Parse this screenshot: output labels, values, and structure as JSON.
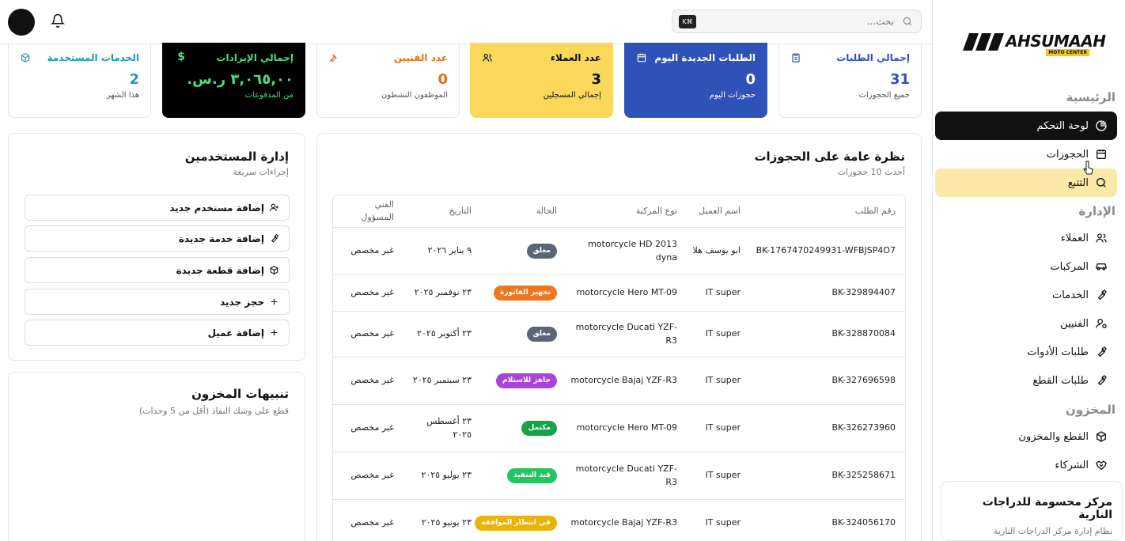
{
  "topbar": {
    "search_placeholder": "بحث...",
    "search_shortcut": "⌘K"
  },
  "sidebar": {
    "logo_text": "AHSUMAAH",
    "logo_sub": "MOTO CENTER",
    "section_main": "الرئيسية",
    "section_admin": "الإدارة",
    "section_inventory": "المخزون",
    "items": {
      "dashboard": "لوحة التحكم",
      "bookings": "الحجوزات",
      "tracking": "التتبع",
      "customers": "العملاء",
      "vehicles": "المركبات",
      "services": "الخدمات",
      "technicians": "الفنيين",
      "tool_requests": "طلبات الأدوات",
      "parts_requests": "طلبات القطع",
      "parts_inventory": "القطع والمخزون",
      "partners": "الشركاء"
    },
    "center_name": "مركز محسومة للدراجات النارية",
    "center_sub": "نظام إدارة مركز الدراجات النارية"
  },
  "stats": {
    "total_orders": {
      "label": "إجمالي الطلبات",
      "value": "31",
      "sub": "جميع الحجوزات"
    },
    "new_today": {
      "label": "الطلبات الجديدة اليوم",
      "value": "0",
      "sub": "حجوزات اليوم"
    },
    "customers": {
      "label": "عدد العملاء",
      "value": "3",
      "sub": "إجمالي المسجلين"
    },
    "technicians": {
      "label": "عدد الفنيين",
      "value": "0",
      "sub": "الموظفون النشطون"
    },
    "revenue": {
      "label": "إجمالي الإيرادات",
      "value": "٣,٠٦٥,٠٠ ر.س.",
      "sub": "من المدفوعات"
    },
    "services": {
      "label": "الخدمات المستخدمة",
      "value": "2",
      "sub": "هذا الشهر"
    }
  },
  "bookings_panel": {
    "title": "نظرة عامة على الحجوزات",
    "subtitle": "أحدث 10 حجوزات",
    "columns": {
      "order": "رقم الطلب",
      "customer": "اسم العميل",
      "vehicle": "نوع المركبة",
      "status": "الحالة",
      "date": "التاريخ",
      "tech": "الفني المسؤول"
    },
    "rows": [
      {
        "order": "BK-1767470249931-WFBJSP4O7",
        "customer": "ابو يوسف هلا",
        "vehicle": "motorcycle HD 2013 dyna",
        "status": "مغلق",
        "status_color": "#5a6675",
        "date": "٩ يناير ٢٠٢٦",
        "tech": "غير مخصص"
      },
      {
        "order": "BK-329894407",
        "customer": "IT super",
        "vehicle": "motorcycle Hero MT-09",
        "status": "تجهيز الفاتورة",
        "status_color": "#f07520",
        "date": "٢٣ نوفمبر ٢٠٢٥",
        "tech": "غير مخصص"
      },
      {
        "order": "BK-328870084",
        "customer": "IT super",
        "vehicle": "motorcycle Ducati YZF-R3",
        "status": "مغلق",
        "status_color": "#5a6675",
        "date": "٢٣ أكتوبر ٢٠٢٥",
        "tech": "غير مخصص"
      },
      {
        "order": "BK-327696598",
        "customer": "IT super",
        "vehicle": "motorcycle Bajaj YZF-R3",
        "status": "جاهز للاستلام",
        "status_color": "#a845d8",
        "date": "٢٣ سبتمبر ٢٠٢٥",
        "tech": "غير مخصص"
      },
      {
        "order": "BK-326273960",
        "customer": "IT super",
        "vehicle": "motorcycle Hero MT-09",
        "status": "مكتمل",
        "status_color": "#16a34a",
        "date": "٢٣ أغسطس ٢٠٢٥",
        "tech": "غير مخصص"
      },
      {
        "order": "BK-325258671",
        "customer": "IT super",
        "vehicle": "motorcycle Ducati YZF-R3",
        "status": "قيد التنفيذ",
        "status_color": "#22c55e",
        "date": "٢٣ يوليو ٢٠٢٥",
        "tech": "غير مخصص"
      },
      {
        "order": "BK-324056170",
        "customer": "IT super",
        "vehicle": "motorcycle Bajaj YZF-R3",
        "status": "في انتظار الموافقة",
        "status_color": "#eab308",
        "date": "٢٣ يونيو ٢٠٢٥",
        "tech": "غير مخصص"
      }
    ]
  },
  "users_panel": {
    "title": "إدارة المستخدمين",
    "subtitle": "إجراءات سريعة",
    "actions": [
      "إضافة مستخدم جديد",
      "إضافة خدمة جديدة",
      "إضافة قطعة جديدة",
      "حجز جديد",
      "إضافة عميل"
    ]
  },
  "inventory_panel": {
    "title": "تنبيهات المخزون",
    "subtitle": "قطع على وشك النفاذ (أقل من 5 وحدات)"
  },
  "colors": {
    "dark": "#111111",
    "blue": "#2f52b8",
    "yellow": "#fcd85a",
    "orange": "#e8701a",
    "teal": "#1d9bb0",
    "green_text": "#4ade80",
    "highlight": "#fce8a8"
  }
}
